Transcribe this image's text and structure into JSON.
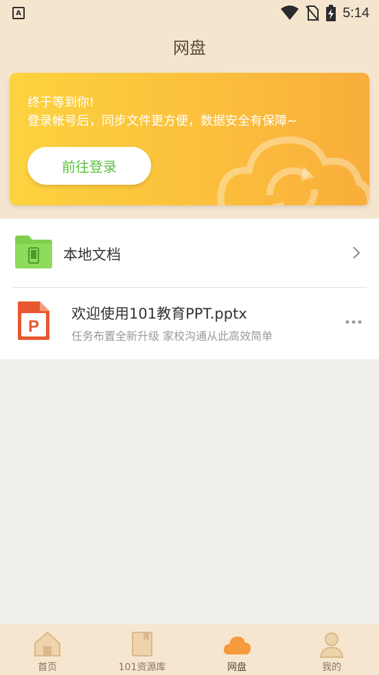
{
  "status_bar": {
    "left_badge": "A",
    "time": "5:14"
  },
  "header": {
    "title": "网盘"
  },
  "banner": {
    "line1": "终于等到你!",
    "line2": "登录帐号后，同步文件更方便，数据安全有保障~",
    "button_label": "前往登录",
    "colors": {
      "start": "#fdd23f",
      "end": "#f8ae3b",
      "button_text": "#5bbf3f"
    }
  },
  "list": {
    "local": {
      "label": "本地文档",
      "icon": "folder-phone-icon"
    },
    "files": [
      {
        "name": "欢迎使用101教育PPT.pptx",
        "subtitle": "任务布置全新升级 家校沟通从此高效简单",
        "icon": "ppt-icon"
      }
    ]
  },
  "tabs": [
    {
      "label": "首页",
      "icon": "home-icon",
      "active": false
    },
    {
      "label": "101资源库",
      "icon": "book-icon",
      "active": false
    },
    {
      "label": "网盘",
      "icon": "cloud-icon",
      "active": true
    },
    {
      "label": "我的",
      "icon": "user-icon",
      "active": false
    }
  ]
}
